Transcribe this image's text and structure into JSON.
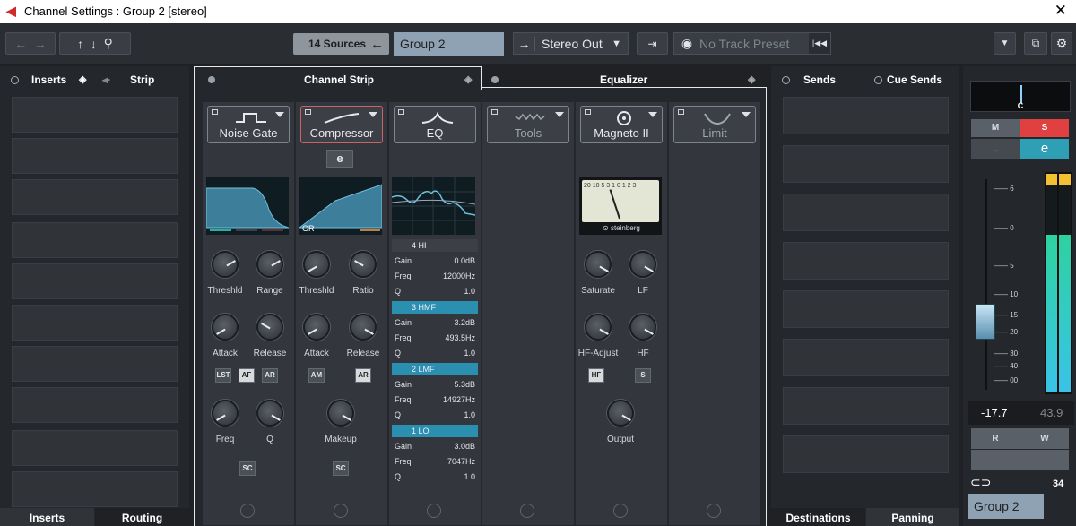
{
  "window": {
    "title": "Channel Settings : Group 2 [stereo]",
    "close": "✕"
  },
  "toolbar": {
    "sources": "14 Sources",
    "sources_arrow": "←",
    "group": "Group 2",
    "output": "Stereo Out",
    "preset": "No Track Preset"
  },
  "left": {
    "tab_inserts": "Inserts",
    "tab_strip": "Strip",
    "bottom_inserts": "Inserts",
    "bottom_routing": "Routing"
  },
  "center": {
    "tab_strip": "Channel Strip",
    "tab_eq": "Equalizer"
  },
  "modules": [
    {
      "name": "Noise Gate",
      "icon": "gate-icon"
    },
    {
      "name": "Compressor",
      "icon": "compressor-icon"
    },
    {
      "name": "EQ",
      "icon": "eq-icon"
    },
    {
      "name": "Tools",
      "icon": "tools-icon"
    },
    {
      "name": "Magneto II",
      "icon": "magneto-icon"
    },
    {
      "name": "Limit",
      "icon": "limit-icon"
    }
  ],
  "gate": {
    "k1": "Threshld",
    "k2": "Range",
    "k3": "Attack",
    "k4": "Release",
    "b1": "LST",
    "b2": "AF",
    "b3": "AR",
    "k5": "Freq",
    "k6": "Q",
    "sc": "SC"
  },
  "comp": {
    "e": "e",
    "gr": "GR",
    "k1": "Threshld",
    "k2": "Ratio",
    "k3": "Attack",
    "k4": "Release",
    "b1": "AM",
    "b2": "AR",
    "k5": "Makeup",
    "sc": "SC"
  },
  "eq": {
    "bands": [
      {
        "name": "4 HI",
        "gain": "0.0dB",
        "freq": "12000Hz",
        "q": "1.0"
      },
      {
        "name": "3 HMF",
        "gain": "3.2dB",
        "freq": "493.5Hz",
        "q": "1.0"
      },
      {
        "name": "2 LMF",
        "gain": "5.3dB",
        "freq": "14927Hz",
        "q": "1.0"
      },
      {
        "name": "1 LO",
        "gain": "3.0dB",
        "freq": "7047Hz",
        "q": "1.0"
      }
    ],
    "gain_label": "Gain",
    "freq_label": "Freq",
    "q_label": "Q"
  },
  "magneto": {
    "brand": "steinberg",
    "k1": "Saturate",
    "k2": "LF",
    "k3": "HF-Adjust",
    "k4": "HF",
    "b1": "HF",
    "b2": "S",
    "k5": "Output",
    "scale": "20 10 5 3 1 0 1 2 3"
  },
  "sends": {
    "tab_sends": "Sends",
    "tab_cue": "Cue Sends",
    "bottom_dest": "Destinations",
    "bottom_pan": "Panning"
  },
  "fader": {
    "pan": "C",
    "m": "M",
    "s": "S",
    "l": "L",
    "e": "e",
    "scale": [
      "6",
      "0",
      "5",
      "10",
      "15",
      "20",
      "30",
      "40",
      "00"
    ],
    "value": "-17.7",
    "peak": "43.9",
    "r": "R",
    "w": "W",
    "link_icon": "link-icon",
    "num": "34",
    "name": "Group 2",
    "level": 0.72
  }
}
